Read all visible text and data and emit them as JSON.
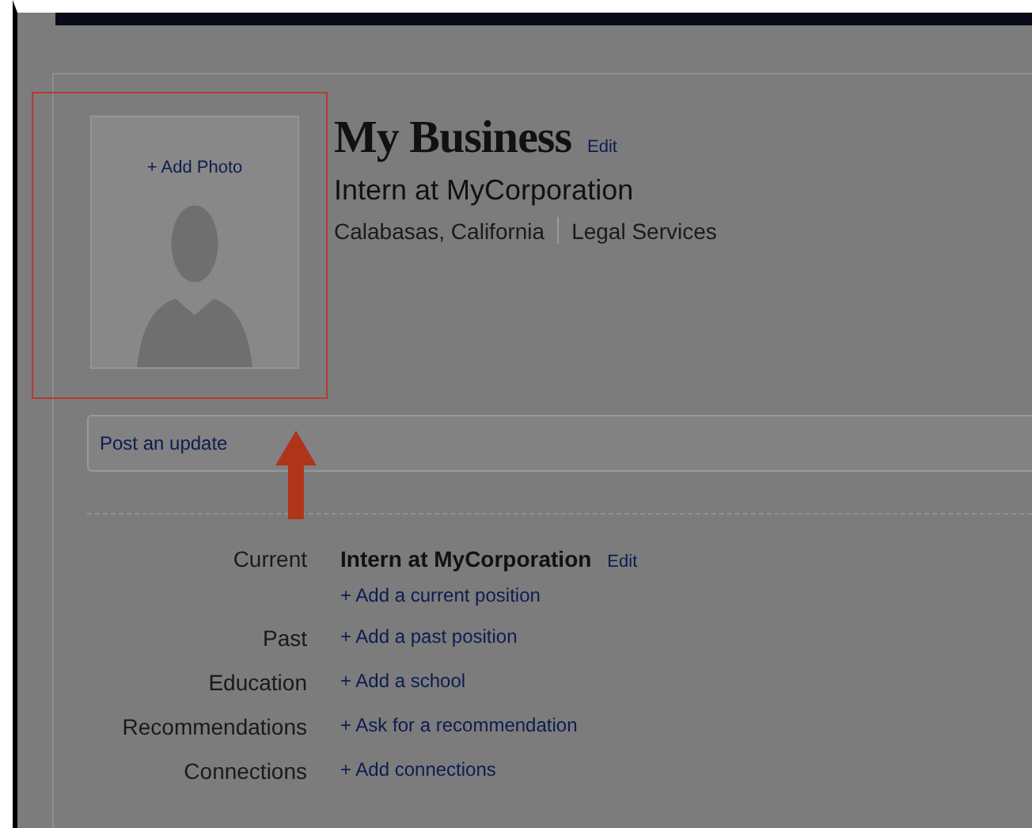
{
  "profile": {
    "photo_link": "+ Add Photo",
    "name": "My Business",
    "name_edit": "Edit",
    "headline": "Intern at MyCorporation",
    "location": "Calabasas, California",
    "industry": "Legal Services"
  },
  "update_box": {
    "placeholder": "Post an update"
  },
  "sections": [
    {
      "label": "Current",
      "entries": [
        {
          "kind": "position",
          "text": "Intern at MyCorporation",
          "edit": "Edit"
        },
        {
          "kind": "link",
          "text": "+ Add a current position"
        }
      ]
    },
    {
      "label": "Past",
      "entries": [
        {
          "kind": "link",
          "text": "+ Add a past position"
        }
      ]
    },
    {
      "label": "Education",
      "entries": [
        {
          "kind": "link",
          "text": "+ Add a school"
        }
      ]
    },
    {
      "label": "Recommendations",
      "entries": [
        {
          "kind": "link",
          "text": "+ Ask for a recommendation"
        }
      ]
    },
    {
      "label": "Connections",
      "entries": [
        {
          "kind": "link",
          "text": "+ Add connections"
        }
      ]
    }
  ]
}
